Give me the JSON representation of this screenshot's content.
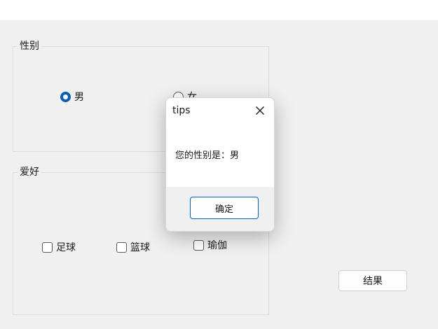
{
  "gender_group": {
    "title": "性别",
    "options": [
      {
        "label": "男",
        "checked": true
      },
      {
        "label": "女",
        "checked": false
      }
    ]
  },
  "hobby_group": {
    "title": "爱好",
    "options": [
      {
        "label": "足球",
        "checked": false
      },
      {
        "label": "篮球",
        "checked": false
      },
      {
        "label": "瑜伽",
        "checked": false
      }
    ]
  },
  "result_button": {
    "label": "结果"
  },
  "dialog": {
    "title": "tips",
    "message": "您的性别是：男",
    "ok_label": "确定",
    "close_icon": "close-icon"
  },
  "colors": {
    "accent": "#0a5fb4",
    "background": "#f0f0f0"
  }
}
